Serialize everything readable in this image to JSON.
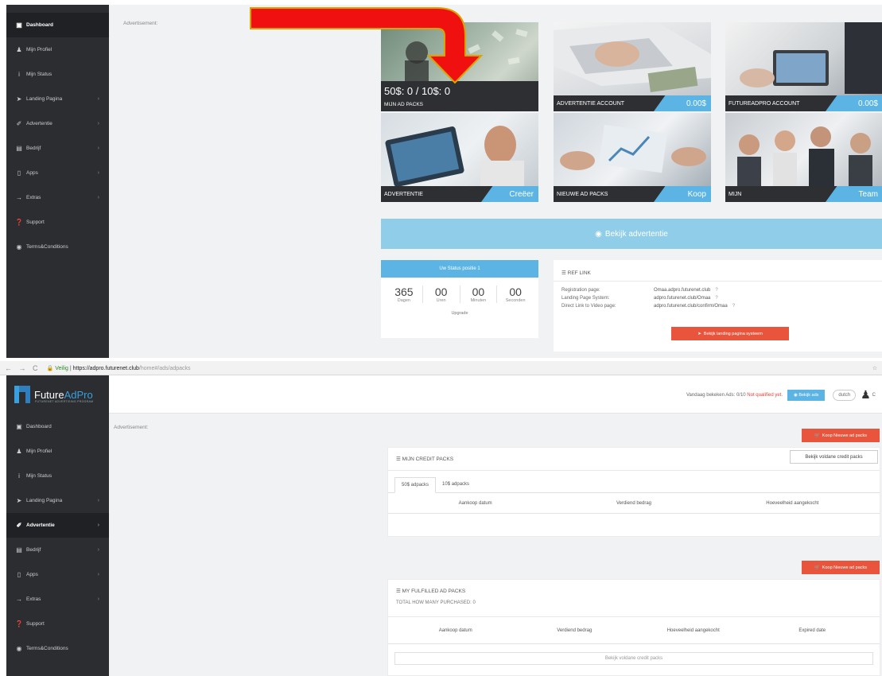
{
  "top": {
    "sidebar": [
      {
        "icon": "▣",
        "icon_name": "dashboard-icon",
        "label": "Dashboard",
        "active": true,
        "chev": false
      },
      {
        "icon": "♟",
        "icon_name": "user-icon",
        "label": "Mijn Profiel",
        "active": false,
        "chev": false
      },
      {
        "icon": "i",
        "icon_name": "info-icon",
        "label": "Mijn Status",
        "active": false,
        "chev": false
      },
      {
        "icon": "➤",
        "icon_name": "send-icon",
        "label": "Landing Pagina",
        "active": false,
        "chev": true
      },
      {
        "icon": "✐",
        "icon_name": "pen-icon",
        "label": "Advertentie",
        "active": false,
        "chev": true
      },
      {
        "icon": "▤",
        "icon_name": "company-icon",
        "label": "Bedrijf",
        "active": false,
        "chev": true
      },
      {
        "icon": "▯",
        "icon_name": "mobile-icon",
        "label": "Apps",
        "active": false,
        "chev": true
      },
      {
        "icon": "→",
        "icon_name": "extras-icon",
        "label": "Extras",
        "active": false,
        "chev": true
      },
      {
        "icon": "❓",
        "icon_name": "support-icon",
        "label": "Support",
        "active": false,
        "chev": false
      },
      {
        "icon": "◉",
        "icon_name": "terms-icon",
        "label": "Terms&Conditions",
        "active": false,
        "chev": false
      }
    ],
    "advertisement_label": "Advertisement:",
    "tiles": [
      {
        "big": "50$: 0 / 10$: 0",
        "caption": "MIJN AD PACKS",
        "blue": ""
      },
      {
        "big": "",
        "caption": "ADVERTENTIE ACCOUNT",
        "blue": "0.00$"
      },
      {
        "big": "",
        "caption": "FUTUREADPRO ACCOUNT",
        "blue": "0.00$"
      },
      {
        "big": "",
        "caption": "ADVERTENTIE",
        "blue": "Creëer"
      },
      {
        "big": "",
        "caption": "NIEUWE AD PACKS",
        "blue": "Koop"
      },
      {
        "big": "",
        "caption": "MIJN",
        "blue": "Team"
      }
    ],
    "view_ad_button": "Bekijk advertentie",
    "status": {
      "header": "Uw Status positie 1",
      "cells": [
        {
          "num": "365",
          "label": "Dagen"
        },
        {
          "num": "00",
          "label": "Uren"
        },
        {
          "num": "00",
          "label": "Minuten"
        },
        {
          "num": "00",
          "label": "Seconden"
        }
      ],
      "upgrade": "Upgrade"
    },
    "ref": {
      "title": "REF LINK",
      "rows": [
        {
          "k": "Registration page:",
          "v": "Omaa.adpro.futurenet.club"
        },
        {
          "k": "Landing Page System:",
          "v": "adpro.futurenet.club/Omaa"
        },
        {
          "k": "Direct Link to Video page:",
          "v": "adpro.futurenet.club/confirm/Omaa"
        }
      ],
      "help": "?",
      "button": "Bekijk landing pagina systeem"
    }
  },
  "browser": {
    "nav": "← → C",
    "secure": "Veilig",
    "host": "https://adpro.futurenet.club",
    "path": "/home#/ads/adpacks",
    "star": "☆"
  },
  "bottom": {
    "logo": {
      "future": "Future",
      "ad": "AdPro",
      "sub": "FUTURENET ADVERTISING PROGRAM"
    },
    "header": {
      "status_text": "Vandaag bekeken Ads: 0/10",
      "status_red": "Not qualified yet.",
      "view_btn": "Bekijk ads",
      "lang": "dutch",
      "user_initial": "C"
    },
    "sidebar": [
      {
        "icon": "▣",
        "icon_name": "dashboard-icon",
        "label": "Dashboard",
        "active": false,
        "chev": false
      },
      {
        "icon": "♟",
        "icon_name": "user-icon",
        "label": "Mijn Profiel",
        "active": false,
        "chev": false
      },
      {
        "icon": "i",
        "icon_name": "info-icon",
        "label": "Mijn Status",
        "active": false,
        "chev": false
      },
      {
        "icon": "➤",
        "icon_name": "send-icon",
        "label": "Landing Pagina",
        "active": false,
        "chev": true
      },
      {
        "icon": "✐",
        "icon_name": "pen-icon",
        "label": "Advertentie",
        "active": true,
        "chev": true
      },
      {
        "icon": "▤",
        "icon_name": "company-icon",
        "label": "Bedrijf",
        "active": false,
        "chev": true
      },
      {
        "icon": "▯",
        "icon_name": "mobile-icon",
        "label": "Apps",
        "active": false,
        "chev": true
      },
      {
        "icon": "→",
        "icon_name": "extras-icon",
        "label": "Extras",
        "active": false,
        "chev": true
      },
      {
        "icon": "❓",
        "icon_name": "support-icon",
        "label": "Support",
        "active": false,
        "chev": false
      },
      {
        "icon": "◉",
        "icon_name": "terms-icon",
        "label": "Terms&Conditions",
        "active": false,
        "chev": false
      }
    ],
    "advertisement_label": "Advertisement:",
    "buy_button": "Koop Nieuwe ad packs",
    "credit": {
      "title": "MIJN CREDIT PACKS",
      "view_btn": "Bekijk voldane credit packs",
      "tabs": [
        "50$ adpacks",
        "10$ adpacks"
      ],
      "columns": [
        "Aankoop datum",
        "Verdiend bedrag",
        "Hoeveelheid aangekocht"
      ]
    },
    "fulfilled": {
      "title": "MY FULFILLED AD PACKS",
      "total": "TOTAL HOW MANY PURCHASED: 0",
      "columns": [
        "Aankoop datum",
        "Verdiend bedrag",
        "Hoeveelheid aangekocht",
        "Expired date"
      ],
      "view_btn": "Bekijk voldane credit packs"
    }
  }
}
